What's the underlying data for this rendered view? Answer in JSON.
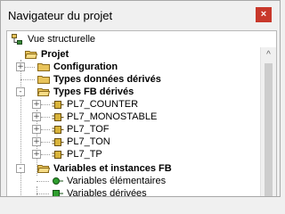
{
  "window": {
    "title": "Navigateur du projet",
    "close_glyph": "×"
  },
  "view_selector": {
    "label": "Vue structurelle",
    "icon": "structure-view-icon"
  },
  "tree": {
    "items": [
      {
        "label": "Projet",
        "bold": true,
        "icon": "open-folder-icon",
        "expander": "-"
      },
      {
        "label": "Configuration",
        "bold": true,
        "icon": "folder-icon",
        "expander": "+"
      },
      {
        "label": "Types données dérivés",
        "bold": true,
        "icon": "folder-icon",
        "expander": ""
      },
      {
        "label": "Types FB dérivés",
        "bold": true,
        "icon": "open-folder-icon",
        "expander": "-"
      },
      {
        "label": "PL7_COUNTER",
        "bold": false,
        "icon": "function-block-icon",
        "expander": "+"
      },
      {
        "label": "PL7_MONOSTABLE",
        "bold": false,
        "icon": "function-block-icon",
        "expander": "+"
      },
      {
        "label": "PL7_TOF",
        "bold": false,
        "icon": "function-block-icon",
        "expander": "+"
      },
      {
        "label": "PL7_TON",
        "bold": false,
        "icon": "function-block-icon",
        "expander": "+"
      },
      {
        "label": "PL7_TP",
        "bold": false,
        "icon": "function-block-icon",
        "expander": "+"
      },
      {
        "label": "Variables et instances FB",
        "bold": true,
        "icon": "open-folder-icon",
        "expander": "-"
      },
      {
        "label": "Variables élémentaires",
        "bold": false,
        "icon": "elementary-variable-icon",
        "expander": ""
      },
      {
        "label": "Variables dérivées",
        "bold": false,
        "icon": "derived-variable-icon",
        "expander": ""
      }
    ]
  },
  "scrollbar": {
    "up_glyph": "^"
  },
  "colors": {
    "close": "#c8382b",
    "folder": "#e8c35a",
    "fb_icon": "#d9b43a",
    "var_green": "#2e9e2e"
  }
}
